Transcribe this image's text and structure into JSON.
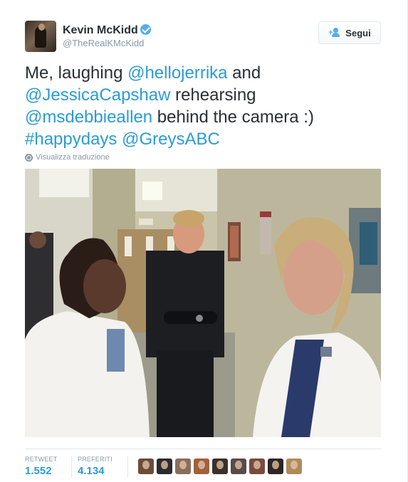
{
  "user": {
    "display_name": "Kevin McKidd",
    "screen_name": "@TheRealKMcKidd",
    "verified": true,
    "avatar_icon": "profile-photo"
  },
  "follow_button": {
    "label": "Segui",
    "icon": "follow-person-plus-icon"
  },
  "tweet": {
    "text_parts": [
      {
        "type": "text",
        "value": "Me, laughing "
      },
      {
        "type": "mention",
        "value": "@hellojerrika"
      },
      {
        "type": "text",
        "value": " and "
      },
      {
        "type": "mention",
        "value": "@JessicaCapshaw"
      },
      {
        "type": "text",
        "value": " rehearsing "
      },
      {
        "type": "mention",
        "value": "@msdebbieallen"
      },
      {
        "type": "text",
        "value": " behind the camera :) "
      },
      {
        "type": "hashtag",
        "value": "#happydays"
      },
      {
        "type": "text",
        "value": " "
      },
      {
        "type": "mention",
        "value": "@GreysABC"
      }
    ],
    "translate_label": "Visualizza traduzione"
  },
  "stats": {
    "retweets_label": "RETWEET",
    "retweets_value": "1.552",
    "favorites_label": "PREFERITI",
    "favorites_value": "4.134"
  },
  "favoriters_count_shown": 9,
  "colors": {
    "link": "#2b9bd6",
    "verified": "#55acee",
    "muted": "#8899a6",
    "text": "#292f33"
  }
}
